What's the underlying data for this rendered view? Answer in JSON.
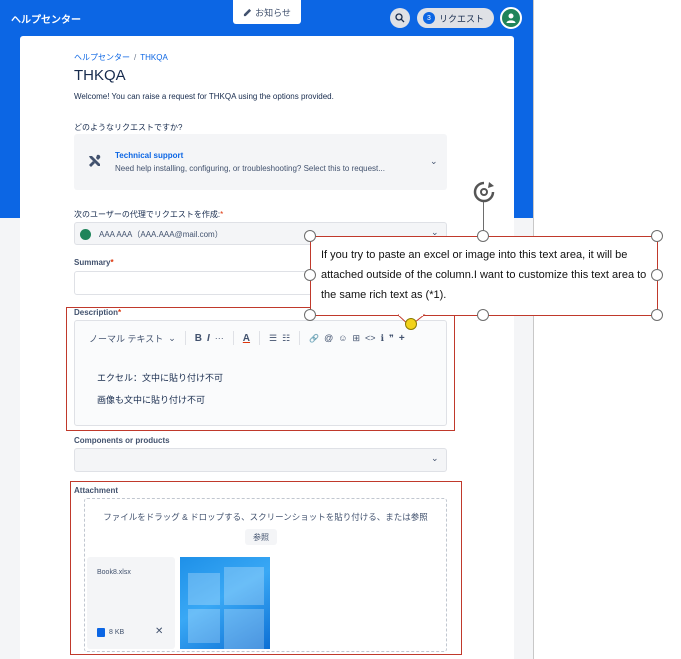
{
  "header": {
    "help_center": "ヘルプセンター",
    "notice": "お知らせ",
    "requests_label": "リクエスト",
    "requests_count": "3"
  },
  "breadcrumb": {
    "home": "ヘルプセンター",
    "separator": "/",
    "current": "THKQA"
  },
  "page": {
    "title": "THKQA",
    "welcome": "Welcome! You can raise a request for THKQA using the options provided."
  },
  "request_type": {
    "question": "どのようなリクエストですか?",
    "name": "Technical support",
    "description": "Need help installing, configuring, or troubleshooting? Select this to request..."
  },
  "on_behalf": {
    "label": "次のユーザーの代理でリクエストを作成:",
    "required_mark": "*",
    "value": "AAA AAA（AAA.AAA@mail.com）"
  },
  "summary": {
    "label": "Summary",
    "required_mark": "*"
  },
  "description": {
    "label": "Description",
    "required_mark": "*",
    "toolbar": {
      "text_style": "ノーマル テキスト",
      "bold": "B",
      "italic": "I",
      "more": "···",
      "color": "A",
      "bullets": "☰",
      "numbers": "☷",
      "link": "🔗",
      "mention": "@",
      "emoji": "☺",
      "table": "⊞",
      "code": "<>",
      "info": "ℹ",
      "quote": "❞",
      "insert": "+"
    },
    "lines": [
      "エクセル：文中に貼り付け不可",
      "画像も文中に貼り付け不可"
    ]
  },
  "components": {
    "label": "Components or products"
  },
  "attachment": {
    "label": "Attachment",
    "dropzone_text": "ファイルをドラッグ & ドロップする、スクリーンショットを貼り付ける、または参照",
    "browse": "参照",
    "file_name": "Book8.xlsx",
    "file_size": "8 KB"
  },
  "callout": {
    "text": "If you try to paste an excel or image into this text area, it will be attached outside of the column.I want to customize this text area to the same rich text as (*1)."
  },
  "colors": {
    "brand_blue": "#0c66e4",
    "annotation_red": "#c0392b",
    "handle_yellow": "#f2d21a"
  },
  "icons": [
    "pencil-icon",
    "search-icon",
    "avatar-icon",
    "tools-icon",
    "chevron-down-icon",
    "close-icon",
    "rotate-icon"
  ]
}
